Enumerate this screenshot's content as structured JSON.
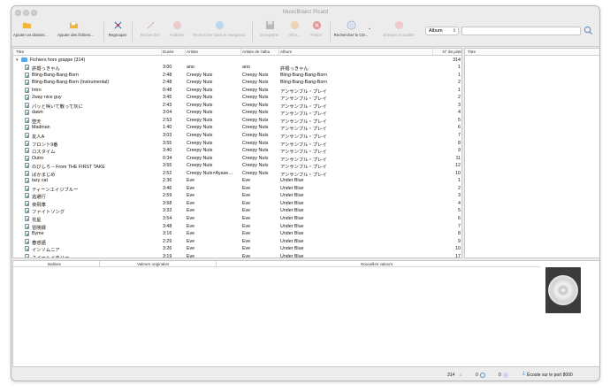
{
  "window": {
    "title": "MusicBrainz Picard"
  },
  "toolbar": {
    "add_folder": "Ajouter un dossier...",
    "add_files": "Ajouter des fichiers...",
    "cluster": "Regrouper",
    "lookup": "Rechercher",
    "scan": "Analyser",
    "browser_lookup": "Rechercher dans le navigateur",
    "save": "Enregistrer",
    "info": "Infos...",
    "remove": "Retirer",
    "lookup_cd": "Rechercher le CD...",
    "submit_acoustid": "Envoyer AcoustID",
    "mode_select": "Album",
    "search_value": ""
  },
  "columns": {
    "title": "Titre",
    "length": "Durée",
    "artist": "Artiste",
    "album_artist": "Artiste de l'albu",
    "album": "Album",
    "track_no": "N° de piste",
    "right_title": "Titre"
  },
  "cluster": {
    "label": "Fichiers hors grappe (314)",
    "count": "314"
  },
  "files": [
    {
      "title": "許婚っきゃん",
      "length": "3:00",
      "artist": "ano",
      "album_artist": "ano",
      "album": "許婚っきゃん",
      "track": "1"
    },
    {
      "title": "Bling-Bang-Bang-Born",
      "length": "2:48",
      "artist": "Creepy Nuts",
      "album_artist": "Creepy Nuts",
      "album": "Bling-Bang-Bang-Born",
      "track": "1"
    },
    {
      "title": "Bling-Bang-Bang-Born (Instrumental)",
      "length": "2:48",
      "artist": "Creepy Nuts",
      "album_artist": "Creepy Nuts",
      "album": "Bling-Bang-Bang-Born",
      "track": "2"
    },
    {
      "title": "Intro",
      "length": "0:48",
      "artist": "Creepy Nuts",
      "album_artist": "Creepy Nuts",
      "album": "アンサンブル・プレイ",
      "track": "1"
    },
    {
      "title": "2way nice guy",
      "length": "3:45",
      "artist": "Creepy Nuts",
      "album_artist": "Creepy Nuts",
      "album": "アンサンブル・プレイ",
      "track": "2"
    },
    {
      "title": "パッと咲いて散って灰に",
      "length": "2:43",
      "artist": "Creepy Nuts",
      "album_artist": "Creepy Nuts",
      "album": "アンサンブル・プレイ",
      "track": "3"
    },
    {
      "title": "dawn",
      "length": "3:04",
      "artist": "Creepy Nuts",
      "album_artist": "Creepy Nuts",
      "album": "アンサンブル・プレイ",
      "track": "4"
    },
    {
      "title": "堕天",
      "length": "2:53",
      "artist": "Creepy Nuts",
      "album_artist": "Creepy Nuts",
      "album": "アンサンブル・プレイ",
      "track": "5"
    },
    {
      "title": "Madman",
      "length": "1:40",
      "artist": "Creepy Nuts",
      "album_artist": "Creepy Nuts",
      "album": "アンサンブル・プレイ",
      "track": "6"
    },
    {
      "title": "友人A",
      "length": "3:03",
      "artist": "Creepy Nuts",
      "album_artist": "Creepy Nuts",
      "album": "アンサンブル・プレイ",
      "track": "7"
    },
    {
      "title": "フロント9番",
      "length": "3:55",
      "artist": "Creepy Nuts",
      "album_artist": "Creepy Nuts",
      "album": "アンサンブル・プレイ",
      "track": "8"
    },
    {
      "title": "ロスタイム",
      "length": "3:40",
      "artist": "Creepy Nuts",
      "album_artist": "Creepy Nuts",
      "album": "アンサンブル・プレイ",
      "track": "9"
    },
    {
      "title": "Outro",
      "length": "0:34",
      "artist": "Creepy Nuts",
      "album_artist": "Creepy Nuts",
      "album": "アンサンブル・プレイ",
      "track": "11"
    },
    {
      "title": "のびしろ – From THE FIRST TAKE",
      "length": "3:55",
      "artist": "Creepy Nuts",
      "album_artist": "Creepy Nuts",
      "album": "アンサンブル・プレイ",
      "track": "12"
    },
    {
      "title": "ばかまじめ",
      "length": "2:52",
      "artist": "Creepy Nuts×Ayase…",
      "album_artist": "Creepy Nuts",
      "album": "アンサンブル・プレイ",
      "track": "10"
    },
    {
      "title": "lazy cat",
      "length": "2:36",
      "artist": "Eve",
      "album_artist": "Eve",
      "album": "Under Blue",
      "track": "1"
    },
    {
      "title": "ティーンエイジブルー",
      "length": "3:46",
      "artist": "Eve",
      "album_artist": "Eve",
      "album": "Under Blue",
      "track": "2"
    },
    {
      "title": "逃避行",
      "length": "2:59",
      "artist": "Eve",
      "album_artist": "Eve",
      "album": "Under Blue",
      "track": "3"
    },
    {
      "title": "夜飛車",
      "length": "3:58",
      "artist": "Eve",
      "album_artist": "Eve",
      "album": "Under Blue",
      "track": "4"
    },
    {
      "title": "ファイトソング",
      "length": "3:33",
      "artist": "Eve",
      "album_artist": "Eve",
      "album": "Under Blue",
      "track": "5"
    },
    {
      "title": "花星",
      "length": "3:54",
      "artist": "Eve",
      "album_artist": "Eve",
      "album": "Under Blue",
      "track": "6"
    },
    {
      "title": "冒険録",
      "length": "3:48",
      "artist": "Eve",
      "album_artist": "Eve",
      "album": "Under Blue",
      "track": "7"
    },
    {
      "title": "Byme",
      "length": "3:16",
      "artist": "Eve",
      "album_artist": "Eve",
      "album": "Under Blue",
      "track": "8"
    },
    {
      "title": "春惑語",
      "length": "2:29",
      "artist": "Eve",
      "album_artist": "Eve",
      "album": "Under Blue",
      "track": "9"
    },
    {
      "title": "インソムニア",
      "length": "3:26",
      "artist": "Eve",
      "album_artist": "Eve",
      "album": "Under Blue",
      "track": "10"
    },
    {
      "title": "スイートメモリー",
      "length": "3:19",
      "artist": "Eve",
      "album_artist": "Eve",
      "album": "Under Blue",
      "track": "17"
    }
  ],
  "metadata": {
    "tag": "Balises",
    "original": "Valeurs originales",
    "new": "Nouvelles valeurs"
  },
  "status": {
    "files_count": "314",
    "pending_files": "0",
    "pending_requests": "0",
    "listen": "Écoute sur le port 8000"
  }
}
